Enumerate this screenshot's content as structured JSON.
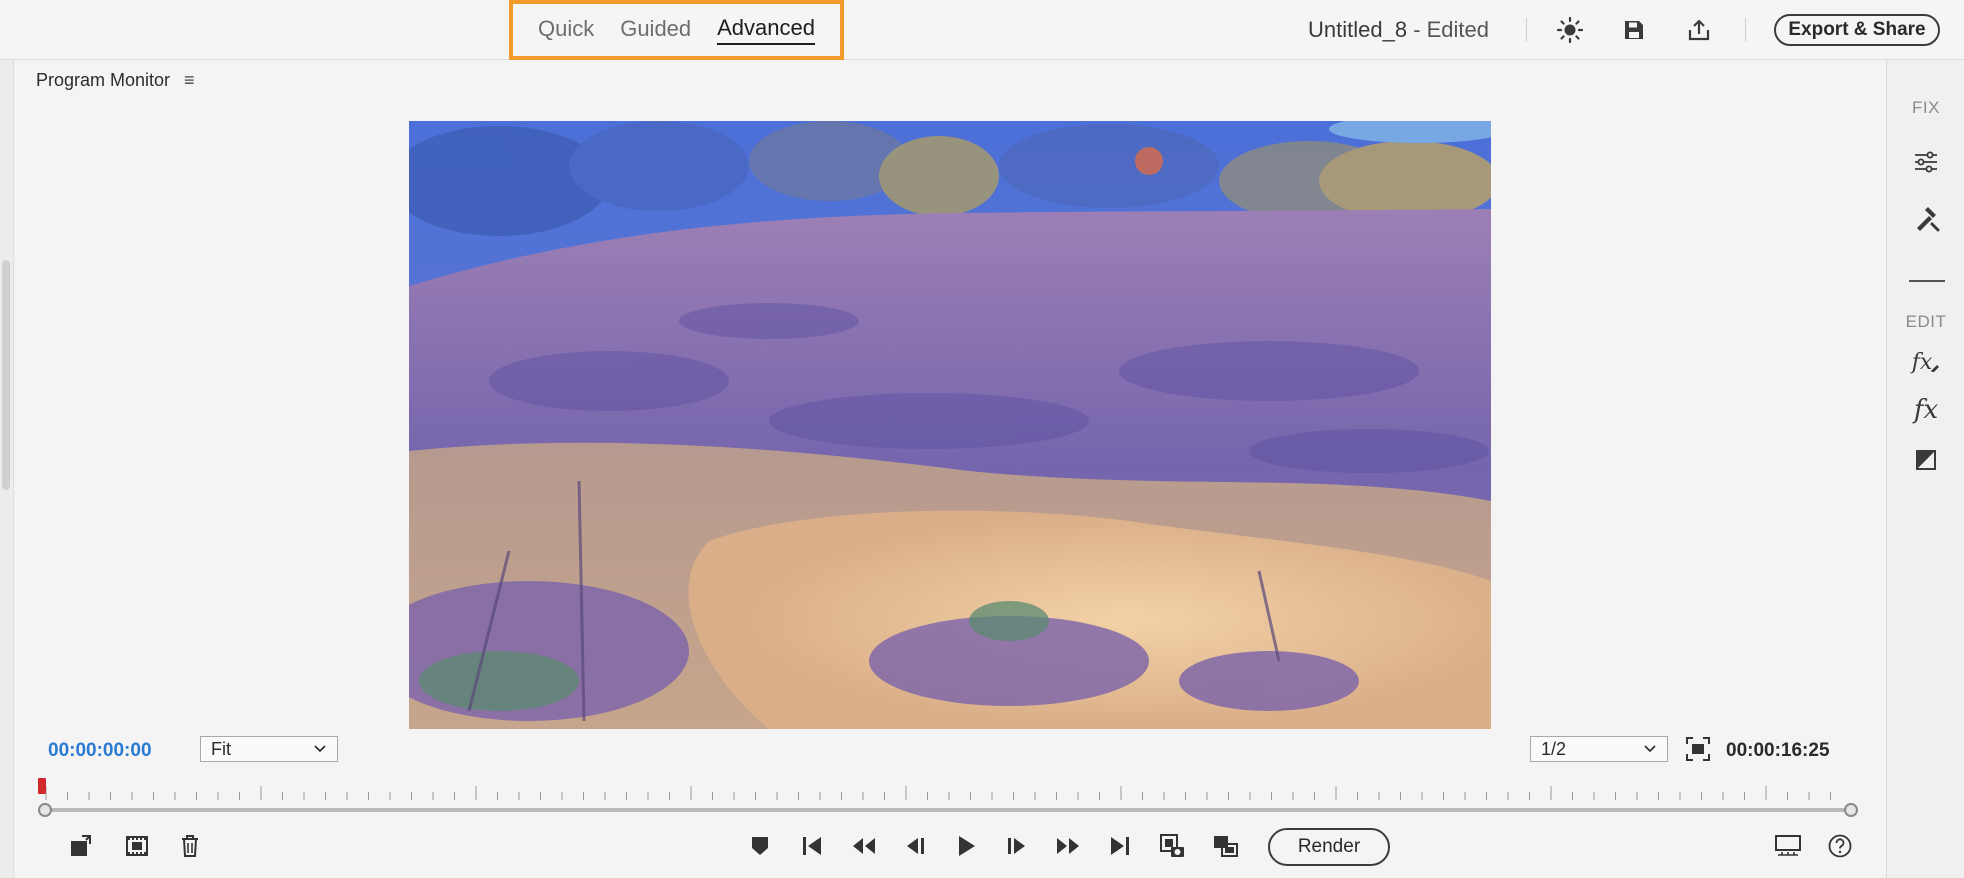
{
  "top": {
    "modes": [
      {
        "label": "Quick",
        "active": false
      },
      {
        "label": "Guided",
        "active": false
      },
      {
        "label": "Advanced",
        "active": true
      }
    ],
    "doc_name": "Untitled_8",
    "doc_status": " - Edited",
    "icons": [
      "brightness-icon",
      "save-icon",
      "share-upload-icon"
    ],
    "export_label": "Export & Share",
    "highlight_color": "#f39a2c"
  },
  "monitor": {
    "title": "Program Monitor",
    "menu_glyph": "≡",
    "current_time": "00:00:00:00",
    "zoom_value": "Fit",
    "resolution_value": "1/2",
    "duration": "00:00:16:25",
    "render_label": "Render",
    "timecode_color": "#2a7ad3",
    "playhead_color": "#d0282c"
  },
  "sidebar": {
    "fix_label": "FIX",
    "edit_label": "EDIT",
    "fx_glyph": "fx"
  }
}
